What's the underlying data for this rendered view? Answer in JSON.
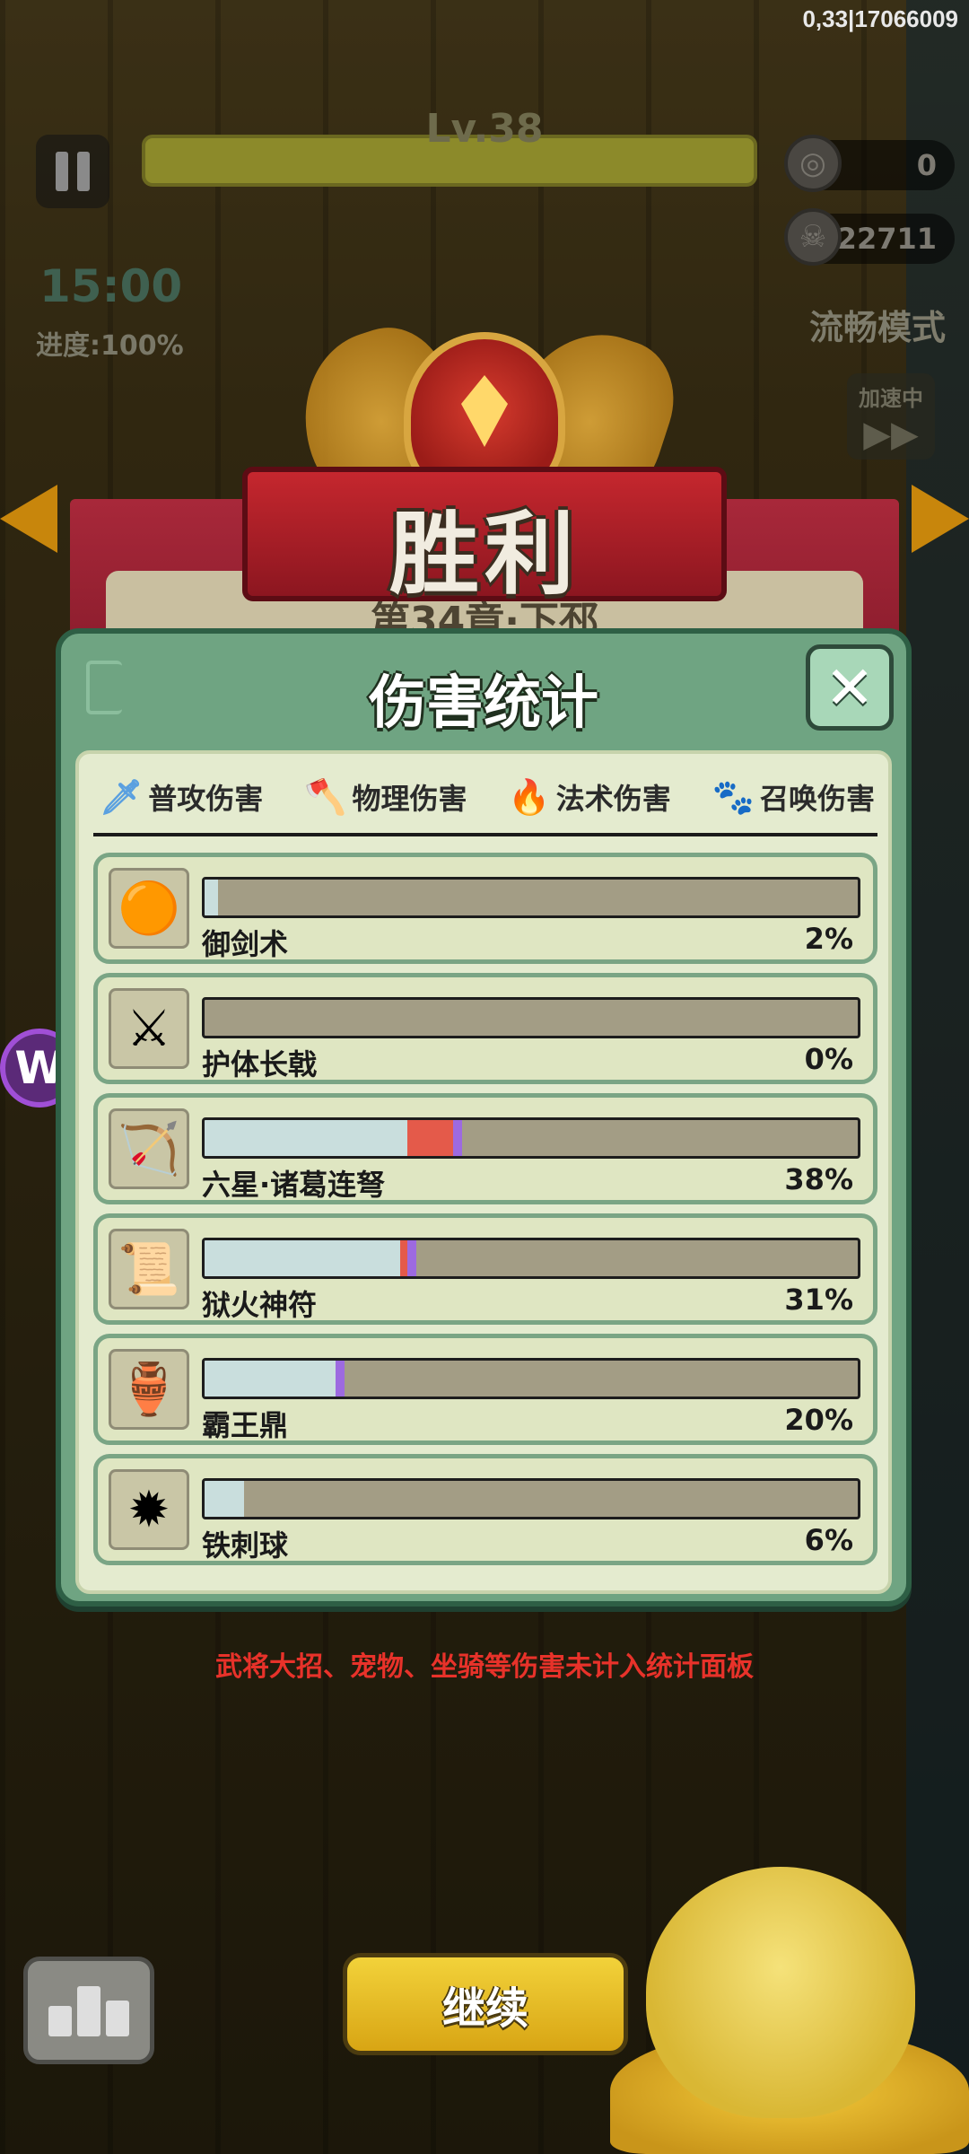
{
  "debug": "0,33|17066009",
  "hud": {
    "level": "Lv.38",
    "coins": "0",
    "kills": "22711",
    "mode": "流畅模式",
    "timer": "15:00",
    "progress": "进度:100%",
    "speed": "加速中"
  },
  "banner": {
    "victory": "胜利",
    "chapter": "第34章·下邳"
  },
  "panel": {
    "title": "伤害统计",
    "close": "✕",
    "tabs": [
      {
        "label": "普攻伤害",
        "icon": "sword-icon"
      },
      {
        "label": "物理伤害",
        "icon": "axe-icon"
      },
      {
        "label": "法术伤害",
        "icon": "fire-icon"
      },
      {
        "label": "召唤伤害",
        "icon": "paw-icon"
      }
    ],
    "rows": [
      {
        "name": "御剑术",
        "pct": "2%",
        "value": 0.02,
        "icon": "flying-sword-orb-icon",
        "red": 0,
        "purple": false
      },
      {
        "name": "护体长戟",
        "pct": "0%",
        "value": 0.0,
        "icon": "halberd-icon",
        "red": 0,
        "purple": false
      },
      {
        "name": "六星·诸葛连弩",
        "pct": "38%",
        "value": 0.38,
        "icon": "crossbow-icon",
        "red": 0.07,
        "purple": true
      },
      {
        "name": "狱火神符",
        "pct": "31%",
        "value": 0.31,
        "icon": "talisman-icon",
        "red": 0.01,
        "purple": true
      },
      {
        "name": "霸王鼎",
        "pct": "20%",
        "value": 0.2,
        "icon": "cauldron-icon",
        "red": 0,
        "purple": true
      },
      {
        "name": "铁刺球",
        "pct": "6%",
        "value": 0.06,
        "icon": "spiked-ball-icon",
        "red": 0,
        "purple": false
      }
    ]
  },
  "note": "武将大招、宠物、坐骑等伤害未计入统计面板",
  "buttons": {
    "continue": "继续"
  },
  "colors": {
    "panel_bg": "#6fa482",
    "bar_fill": "#c9dedd",
    "bar_empty": "#a39d85",
    "red_segment": "#e45a4a",
    "purple_segment": "#9d6ae0",
    "note": "#e8322a"
  }
}
